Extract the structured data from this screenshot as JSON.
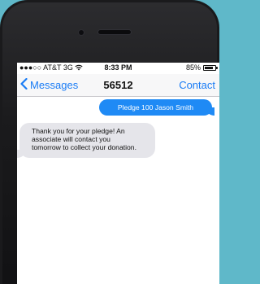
{
  "status_bar": {
    "carrier": "●●●○○ AT&T 3G",
    "time": "8:33 PM",
    "battery": "85%",
    "battery_level": 0.85
  },
  "nav": {
    "back_label": "Messages",
    "title": "56512",
    "contact_label": "Contact"
  },
  "messages": {
    "outgoing": "Pledge  100 Jason Smith",
    "incoming_lines": [
      "Thank you for your pledge! An",
      "associate will contact you",
      "tomorrow to collect your donation."
    ]
  },
  "icons": {
    "wifi": "wifi-icon",
    "back": "chevron-left-icon",
    "battery": "battery-icon"
  },
  "colors": {
    "background": "#5fb8c9",
    "accent": "#1a7cf5",
    "outgoing_bubble": "#1f8af5",
    "incoming_bubble": "#e5e5ea"
  }
}
